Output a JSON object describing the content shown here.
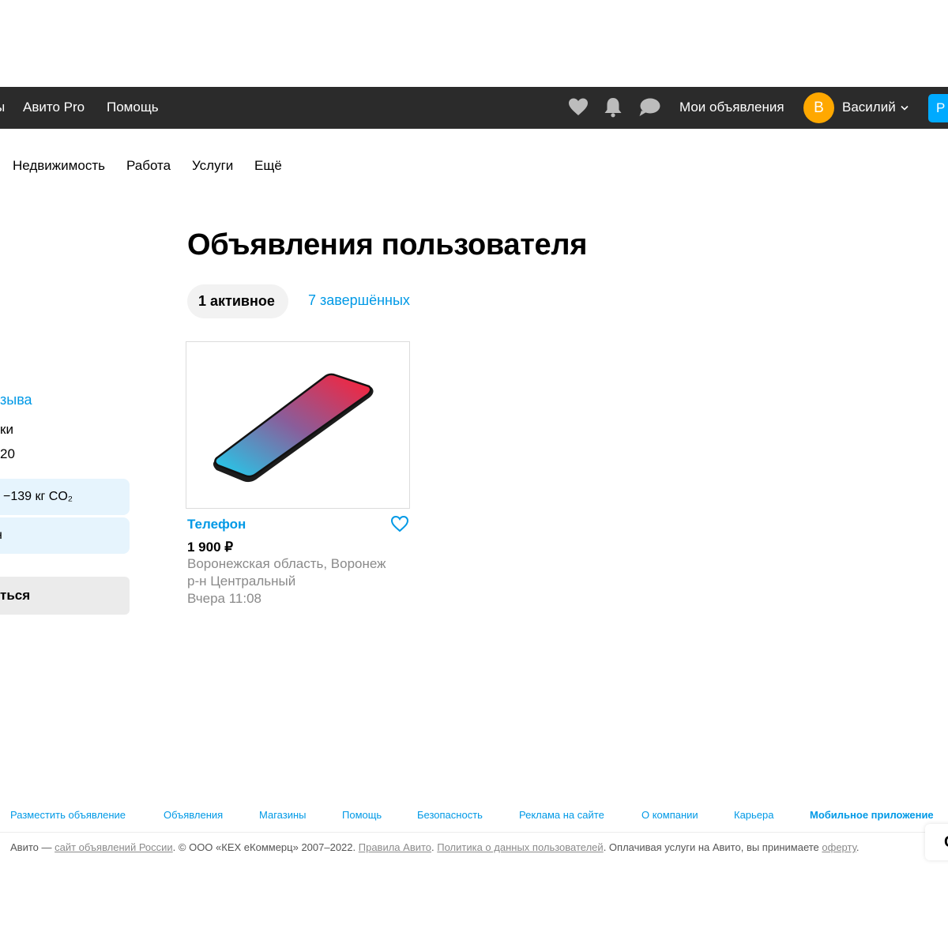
{
  "top_nav": {
    "left_cut_item": "ы",
    "items": [
      "Авито Pro",
      "Помощь"
    ],
    "icons": [
      "heart-icon",
      "bell-icon",
      "chat-icon"
    ],
    "my_ads": "Мои объявления",
    "avatar_letter": "В",
    "user_name": "Василий",
    "post_button_cut": "Р"
  },
  "categories": [
    "Недвижимость",
    "Работа",
    "Услуги",
    "Ещё"
  ],
  "left_panel": {
    "reviews_cut": "зыва",
    "line1_cut": "ки",
    "line2_cut": "20",
    "eco_saved": "−139 кг CO₂",
    "eco_line2_cut": "н",
    "action_cut": "ться"
  },
  "main": {
    "title": "Объявления пользователя",
    "tabs": [
      {
        "label": "1 активное",
        "active": true
      },
      {
        "label": "7 завершённых",
        "active": false
      }
    ]
  },
  "listing": {
    "title": "Телефон",
    "price": "1 900 ₽",
    "location_line1": "Воронежская область, Воронеж",
    "location_line2": "р-н Центральный",
    "date": "Вчера 11:08"
  },
  "footer": {
    "links": [
      "Разместить объявление",
      "Объявления",
      "Магазины",
      "Помощь",
      "Безопасность",
      "Реклама на сайте",
      "О компании",
      "Карьера",
      "Мобильное приложение"
    ],
    "legal_prefix": "Авито — ",
    "legal_link1": "сайт объявлений России",
    "legal_mid": ". © ООО «КЕХ еКоммерц» 2007–2022. ",
    "legal_link2": "Правила Авито",
    "legal_sep": ". ",
    "legal_link3": "Политика о данных пользователей",
    "legal_mid2": ". Оплачивая услуги на Авито, вы принимаете ",
    "legal_link4": "оферту",
    "legal_end": ".",
    "side_widget_cut": "С"
  },
  "colors": {
    "accent": "#0099e6",
    "topbar": "#2b2b2b",
    "avatar": "#ffa800",
    "post_button": "#00aaff"
  }
}
